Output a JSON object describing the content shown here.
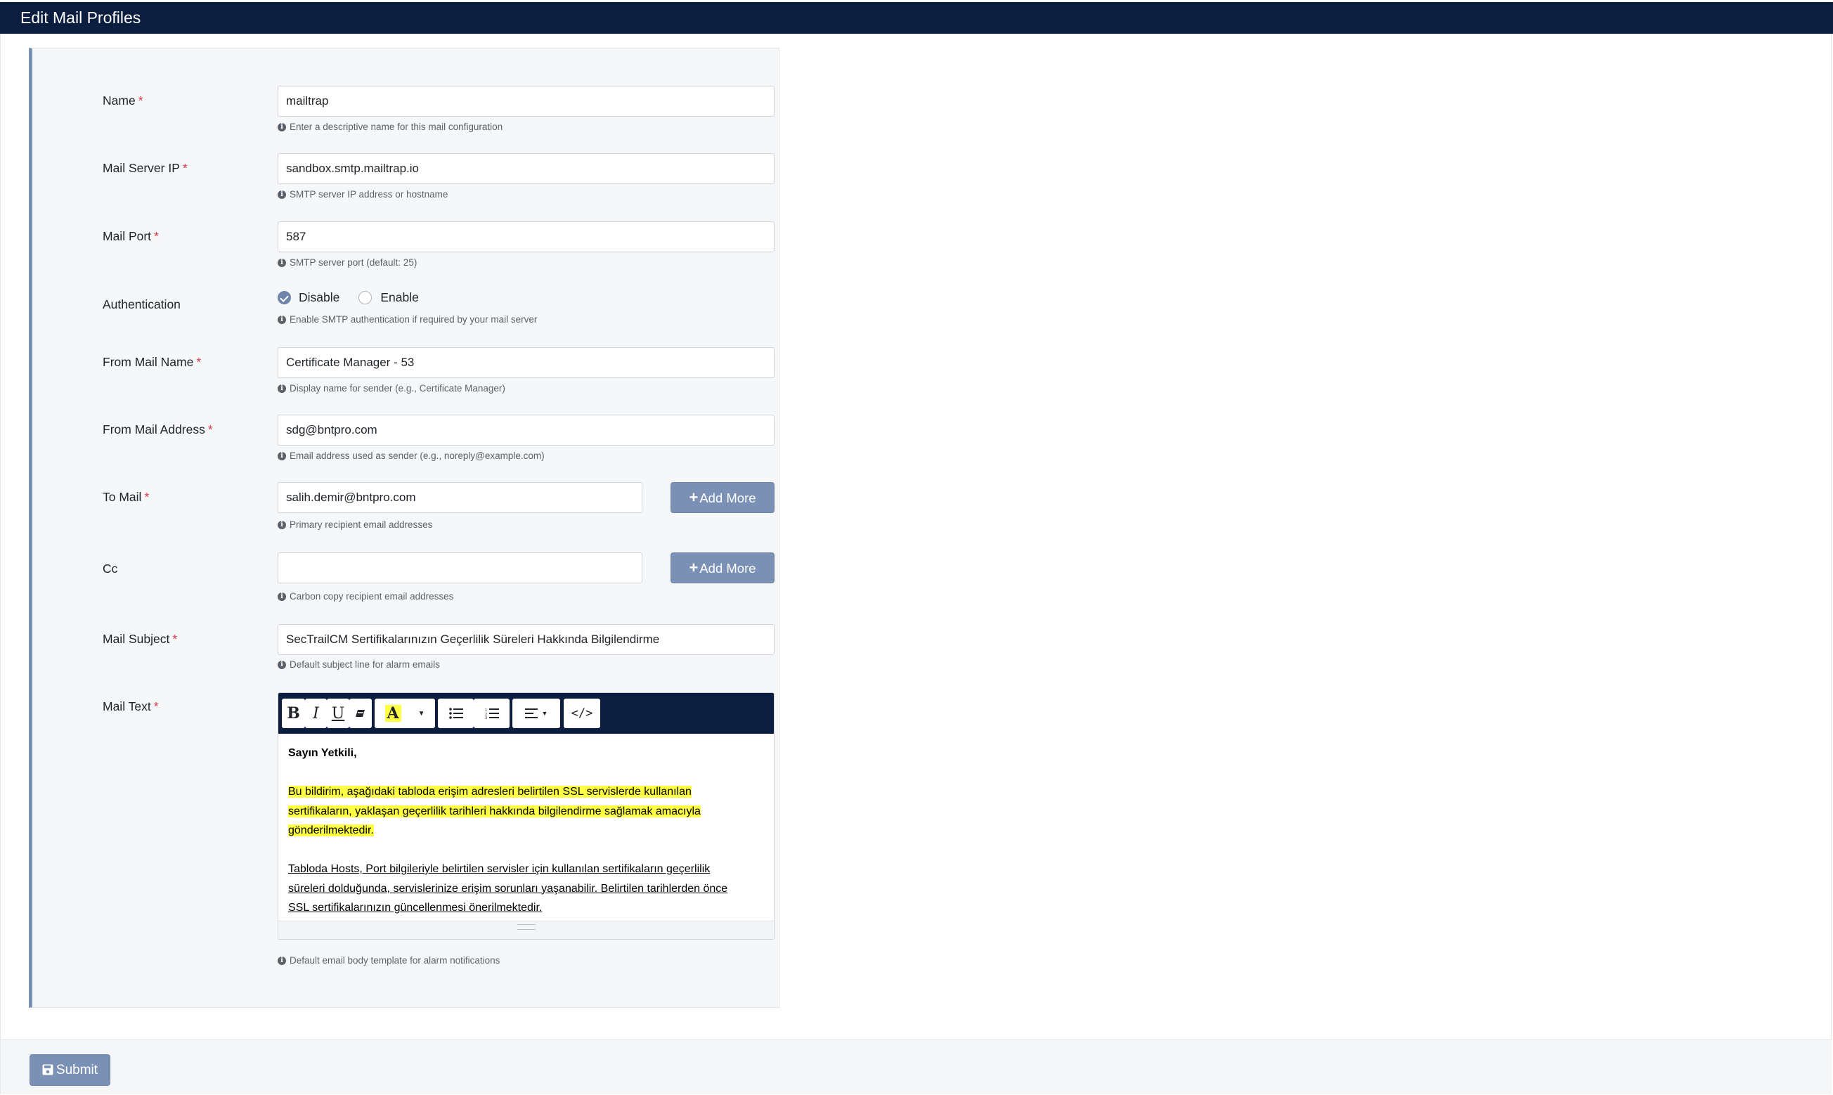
{
  "header": {
    "title": "Edit Mail Profiles"
  },
  "form": {
    "name": {
      "label": "Name",
      "required": "*",
      "value": "mailtrap",
      "help": "Enter a descriptive name for this mail configuration"
    },
    "server_ip": {
      "label": "Mail Server IP",
      "required": "*",
      "value": "sandbox.smtp.mailtrap.io",
      "help": "SMTP server IP address or hostname"
    },
    "port": {
      "label": "Mail Port",
      "required": "*",
      "value": "587",
      "help": "SMTP server port (default: 25)"
    },
    "authentication": {
      "label": "Authentication",
      "options": [
        "Disable",
        "Enable"
      ],
      "selected": "Disable",
      "help": "Enable SMTP authentication if required by your mail server"
    },
    "from_name": {
      "label": "From Mail Name",
      "required": "*",
      "value": "Certificate Manager - 53",
      "help": "Display name for sender (e.g., Certificate Manager)"
    },
    "from_address": {
      "label": "From Mail Address",
      "required": "*",
      "value": "sdg@bntpro.com",
      "help": "Email address used as sender (e.g., noreply@example.com)"
    },
    "to_mail": {
      "label": "To Mail",
      "required": "*",
      "value": "salih.demir@bntpro.com",
      "add_more": "Add More",
      "help": "Primary recipient email addresses"
    },
    "cc": {
      "label": "Cc",
      "value": "",
      "add_more": "Add More",
      "help": "Carbon copy recipient email addresses"
    },
    "subject": {
      "label": "Mail Subject",
      "required": "*",
      "value": "SecTrailCM Sertifikalarınızın Geçerlilik Süreleri Hakkında Bilgilendirme",
      "help": "Default subject line for alarm emails"
    },
    "mail_text": {
      "label": "Mail Text",
      "required": "*",
      "toolbar": {
        "bold": "B",
        "italic": "I",
        "underline": "U",
        "color": "A",
        "code": "</>"
      },
      "greeting": "Sayın Yetkili,",
      "para1_lines": [
        "Bu bildirim, aşağıdaki tabloda erişim adresleri belirtilen SSL servislerde kullanılan",
        "sertifikaların, yaklaşan geçerlilik tarihleri hakkında bilgilendirme sağlamak amacıyla",
        "gönderilmektedir."
      ],
      "para2_lines": [
        "Tabloda Hosts, Port bilgileriyle belirtilen servisler için kullanılan sertifikaların geçerlilik",
        "süreleri dolduğunda, servislerinize erişim sorunları yaşanabilir. Belirtilen tarihlerden önce",
        "SSL sertifikalarınızın güncellenmesi önerilmektedir."
      ],
      "highlight_color": "#ffff44",
      "help": "Default email body template for alarm notifications"
    }
  },
  "footer": {
    "submit": "Submit"
  },
  "colors": {
    "header_bg": "#0c1e3f",
    "button_bg": "#7b90b5",
    "required": "#dc3545"
  }
}
